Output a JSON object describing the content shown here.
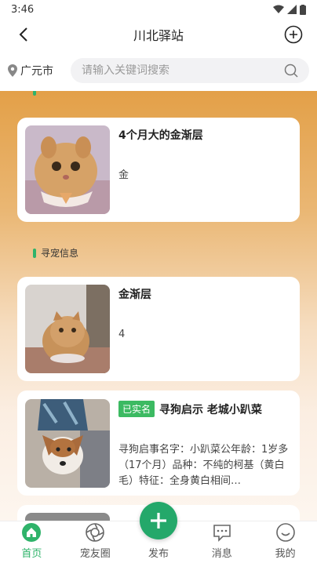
{
  "status": {
    "time": "3:46"
  },
  "header": {
    "title": "川北驿站"
  },
  "search": {
    "city": "广元市",
    "placeholder": "请输入关键词搜索"
  },
  "sections": {
    "lost": "寻宠信息"
  },
  "cards": [
    {
      "title": "4个月大的金渐层",
      "desc": "金"
    },
    {
      "title": "金渐层",
      "desc": "4"
    },
    {
      "badge": "已实名",
      "title": "寻狗启示 老城小趴菜",
      "desc": "寻狗启事名字：小趴菜公年龄：1岁多（17个月）品种：不纯的柯基（黄白毛）特征：全身黄白相间…"
    }
  ],
  "tabs": [
    {
      "label": "首页",
      "icon": "home-icon"
    },
    {
      "label": "宠友圈",
      "icon": "aperture-icon"
    },
    {
      "label": "发布",
      "icon": "plus-icon"
    },
    {
      "label": "消息",
      "icon": "chat-icon"
    },
    {
      "label": "我的",
      "icon": "smile-icon"
    }
  ],
  "colors": {
    "accent": "#2fb36a",
    "fab": "#24a86a",
    "gradient_top": "#e3a048"
  }
}
